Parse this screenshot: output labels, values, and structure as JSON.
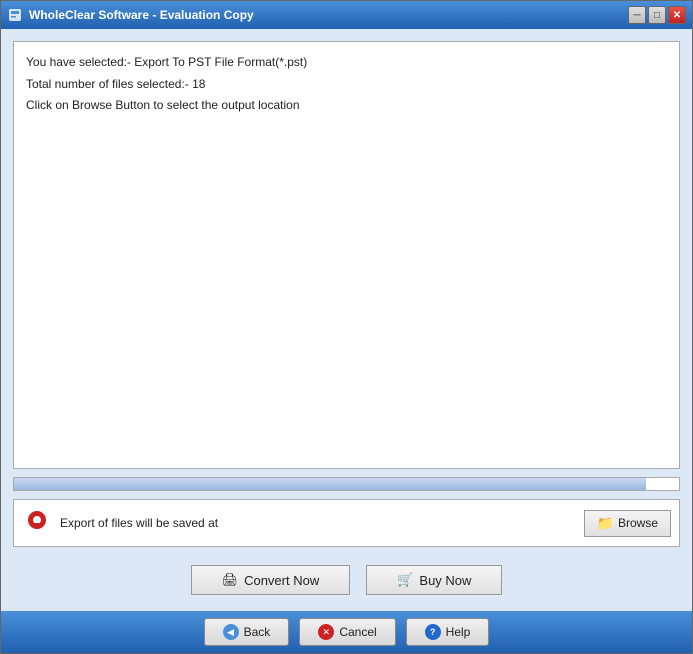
{
  "window": {
    "title": "WholeClear Software - Evaluation Copy",
    "icon": "app-icon"
  },
  "title_buttons": {
    "minimize": "─",
    "maximize": "□",
    "close": "✕"
  },
  "info_box": {
    "line1": "You have selected:- Export To PST File Format(*.pst)",
    "line2": "Total number of files selected:- 18",
    "line3": "Click on Browse Button to select the output location"
  },
  "progress": {
    "value": 95
  },
  "location": {
    "label": "Export of files will be saved at",
    "browse_label": "Browse"
  },
  "actions": {
    "convert_label": "Convert Now",
    "buy_label": "Buy Now"
  },
  "nav": {
    "back_label": "Back",
    "cancel_label": "Cancel",
    "help_label": "Help"
  }
}
